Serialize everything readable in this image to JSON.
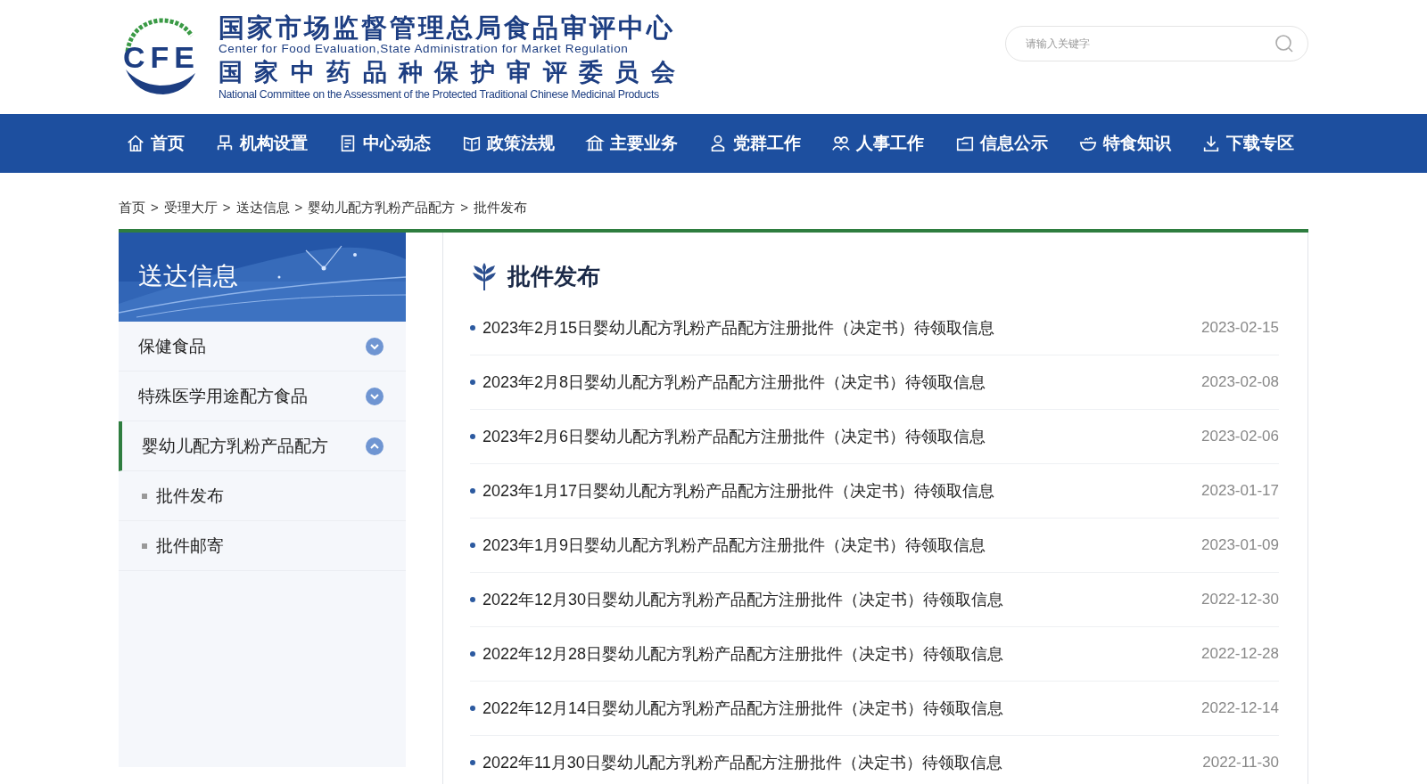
{
  "header": {
    "logo_text": "CFE",
    "title_cn": "国家市场监督管理总局食品审评中心",
    "title_en": "Center for Food Evaluation,State Administration for Market Regulation",
    "subtitle_cn": "国家中药品种保护审评委员会",
    "subtitle_en": "National Committee on the Assessment of the Protected Traditional Chinese Medicinal Products"
  },
  "search": {
    "placeholder": "请输入关键字"
  },
  "nav": [
    {
      "label": "首页"
    },
    {
      "label": "机构设置"
    },
    {
      "label": "中心动态"
    },
    {
      "label": "政策法规"
    },
    {
      "label": "主要业务"
    },
    {
      "label": "党群工作"
    },
    {
      "label": "人事工作"
    },
    {
      "label": "信息公示"
    },
    {
      "label": "特食知识"
    },
    {
      "label": "下载专区"
    }
  ],
  "breadcrumb": [
    "首页",
    "受理大厅",
    "送达信息",
    "婴幼儿配方乳粉产品配方",
    "批件发布"
  ],
  "breadcrumb_separator": ">",
  "sidebar": {
    "title": "送达信息",
    "items": [
      {
        "label": "保健食品",
        "selected": false,
        "expanded": false
      },
      {
        "label": "特殊医学用途配方食品",
        "selected": false,
        "expanded": false
      },
      {
        "label": "婴幼儿配方乳粉产品配方",
        "selected": true,
        "expanded": true,
        "children": [
          {
            "label": "批件发布"
          },
          {
            "label": "批件邮寄"
          }
        ]
      }
    ]
  },
  "main": {
    "title": "批件发布",
    "items": [
      {
        "title": "2023年2月15日婴幼儿配方乳粉产品配方注册批件（决定书）待领取信息",
        "date": "2023-02-15"
      },
      {
        "title": "2023年2月8日婴幼儿配方乳粉产品配方注册批件（决定书）待领取信息",
        "date": "2023-02-08"
      },
      {
        "title": "2023年2月6日婴幼儿配方乳粉产品配方注册批件（决定书）待领取信息",
        "date": "2023-02-06"
      },
      {
        "title": "2023年1月17日婴幼儿配方乳粉产品配方注册批件（决定书）待领取信息",
        "date": "2023-01-17"
      },
      {
        "title": "2023年1月9日婴幼儿配方乳粉产品配方注册批件（决定书）待领取信息",
        "date": "2023-01-09"
      },
      {
        "title": "2022年12月30日婴幼儿配方乳粉产品配方注册批件（决定书）待领取信息",
        "date": "2022-12-30"
      },
      {
        "title": "2022年12月28日婴幼儿配方乳粉产品配方注册批件（决定书）待领取信息",
        "date": "2022-12-28"
      },
      {
        "title": "2022年12月14日婴幼儿配方乳粉产品配方注册批件（决定书）待领取信息",
        "date": "2022-12-14"
      },
      {
        "title": "2022年11月30日婴幼儿配方乳粉产品配方注册批件（决定书）待领取信息",
        "date": "2022-11-30"
      }
    ]
  }
}
